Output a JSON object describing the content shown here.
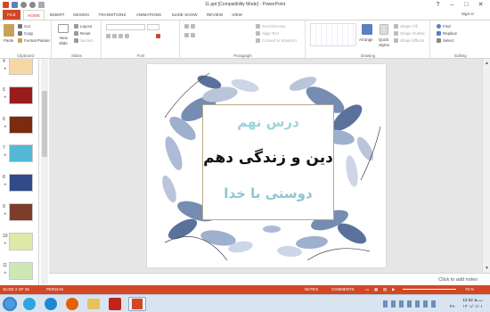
{
  "window": {
    "title": "11.ppt [Compatibility Mode] - PowerPoint",
    "sign_in": "Sign in",
    "minimize": "–",
    "restore": "□",
    "close": "✕",
    "help": "?"
  },
  "tabs": [
    "FILE",
    "HOME",
    "INSERT",
    "DESIGN",
    "TRANSITIONS",
    "ANIMATIONS",
    "SLIDE SHOW",
    "REVIEW",
    "VIEW"
  ],
  "ribbon": {
    "clipboard": {
      "label": "Clipboard",
      "paste": "Paste",
      "cut": "Cut",
      "copy": "Copy",
      "format_painter": "Format Painter"
    },
    "slides": {
      "label": "Slides",
      "new_slide": "New",
      "new_slide_2": "Slide",
      "layout": "Layout",
      "reset": "Reset",
      "section": "Section"
    },
    "font": {
      "label": "Font"
    },
    "paragraph": {
      "label": "Paragraph",
      "text_direction": "Text Direction",
      "align_text": "Align Text",
      "convert_smartart": "Convert to SmartArt"
    },
    "drawing": {
      "label": "Drawing",
      "arrange": "Arrange",
      "quick_styles": "Quick",
      "quick_styles_2": "Styles",
      "shape_fill": "Shape Fill",
      "shape_outline": "Shape Outline",
      "shape_effects": "Shape Effects"
    },
    "editing": {
      "label": "Editing",
      "find": "Find",
      "replace": "Replace",
      "select": "Select"
    }
  },
  "thumbnails": [
    {
      "num": "4",
      "color": "#f6d7a6",
      "star": "★"
    },
    {
      "num": "5",
      "color": "#9a1d1d",
      "star": "★"
    },
    {
      "num": "6",
      "color": "#7a2b10",
      "star": "★"
    },
    {
      "num": "7",
      "color": "#53b9d6",
      "star": "★"
    },
    {
      "num": "8",
      "color": "#304a8a",
      "star": "★"
    },
    {
      "num": "9",
      "color": "#7c3d2a",
      "star": "★"
    },
    {
      "num": "10",
      "color": "#dfe9a8",
      "star": "★"
    },
    {
      "num": "11",
      "color": "#cde8b5",
      "star": "★"
    }
  ],
  "slide": {
    "line1": "درس نهم",
    "line2": "دین و زندگی دهم",
    "line3": "دوستی با خدا",
    "line1_color": "#9cd3de",
    "line2_color": "#111111",
    "line3_color": "#8fc5d2"
  },
  "notes": {
    "placeholder": "Click to add notes"
  },
  "status": {
    "slide_info": "SLIDE 2 OF 35",
    "language": "PERSIAN",
    "notes": "NOTES",
    "comments": "COMMENTS",
    "zoom": "70 %",
    "accent": "#d24726"
  },
  "taskbar": {
    "time": "12:32 ب.ظ",
    "date": "۱۴۰۱/۰۱/۰۱",
    "lang": "FA"
  }
}
